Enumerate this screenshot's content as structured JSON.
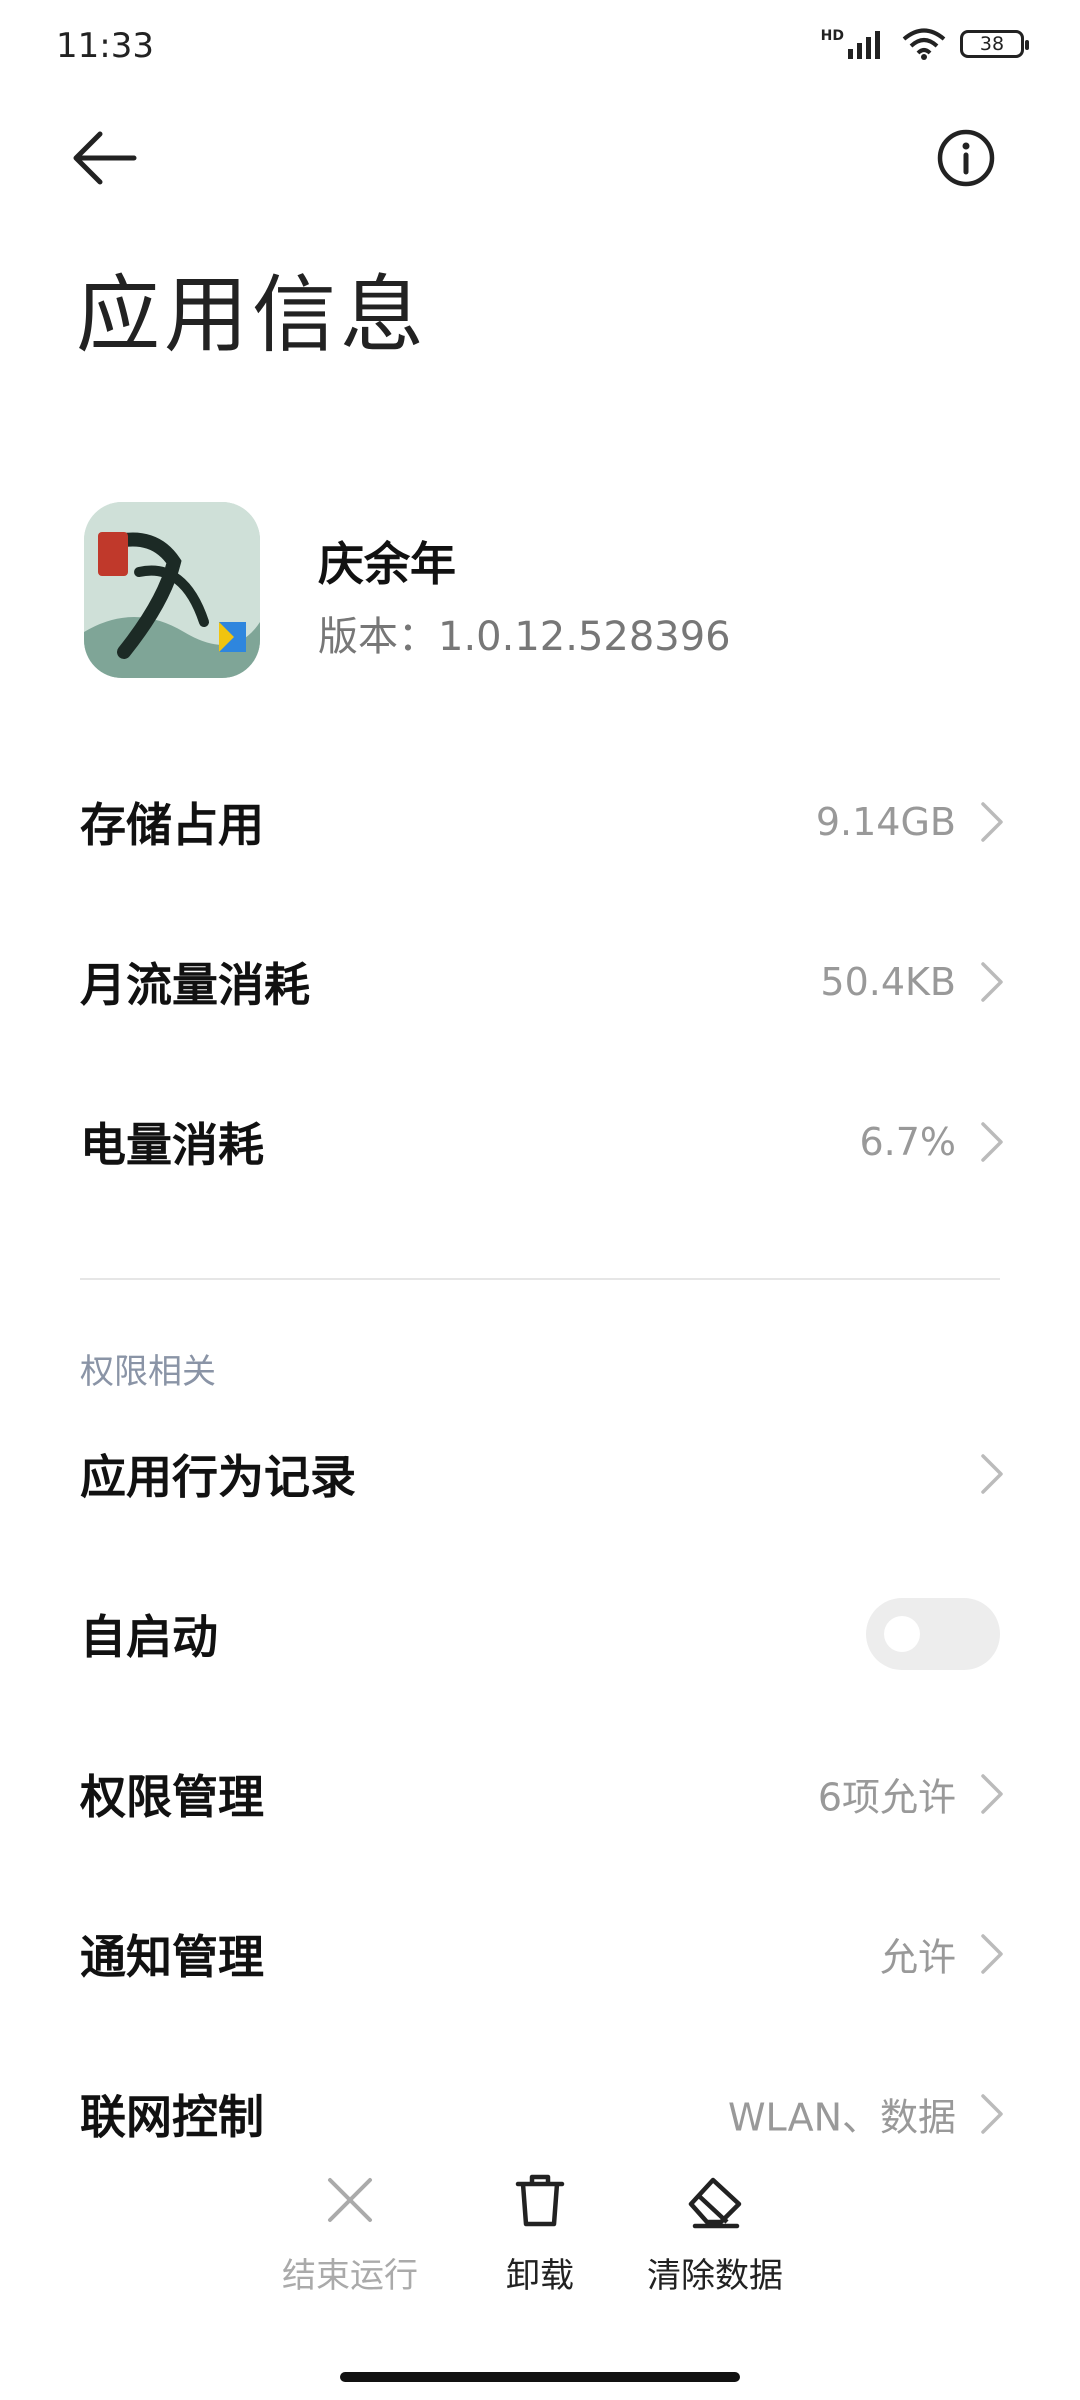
{
  "status_bar": {
    "time": "11:33",
    "network": "HD",
    "battery": "38"
  },
  "header": {
    "title": "应用信息"
  },
  "app": {
    "name": "庆余年",
    "version": "版本：1.0.12.528396"
  },
  "usage_rows": [
    {
      "label": "存储占用",
      "value": "9.14GB"
    },
    {
      "label": "月流量消耗",
      "value": "50.4KB"
    },
    {
      "label": "电量消耗",
      "value": "6.7%"
    }
  ],
  "permissions_section": {
    "header": "权限相关",
    "rows": [
      {
        "label": "应用行为记录",
        "value": ""
      },
      {
        "label": "自启动",
        "toggle": false
      },
      {
        "label": "权限管理",
        "value": "6项允许"
      },
      {
        "label": "通知管理",
        "value": "允许"
      },
      {
        "label": "联网控制",
        "value": "WLAN、数据"
      }
    ]
  },
  "actions": [
    {
      "label": "结束运行",
      "icon": "close-icon",
      "enabled": false
    },
    {
      "label": "卸载",
      "icon": "trash-icon",
      "enabled": true
    },
    {
      "label": "清除数据",
      "icon": "eraser-icon",
      "enabled": true
    }
  ],
  "colors": {
    "secondary_text": "#999999",
    "section_header": "#8a94a6",
    "toggle_off": "#ededed"
  }
}
